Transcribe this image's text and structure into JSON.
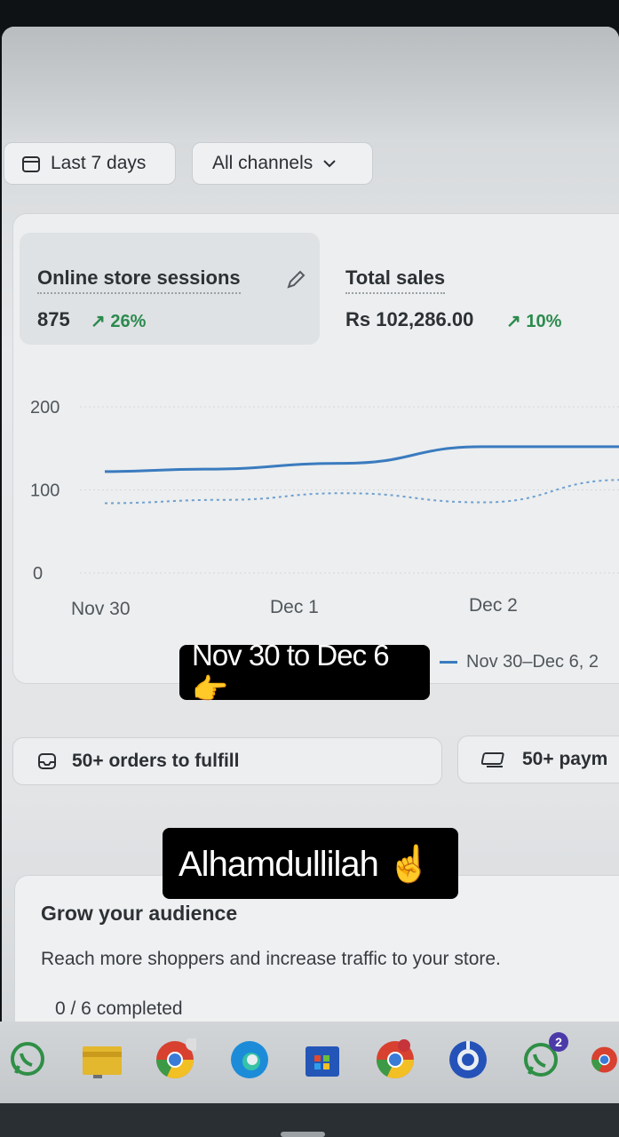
{
  "filters": {
    "date_range": "Last 7 days",
    "channels": "All channels"
  },
  "metrics": {
    "sessions": {
      "label": "Online store sessions",
      "value": "875",
      "delta": "26%"
    },
    "sales": {
      "label": "Total sales",
      "value": "Rs 102,286.00",
      "delta": "10%"
    }
  },
  "chart_data": {
    "type": "line",
    "x": [
      "Nov 30",
      "Dec 1",
      "Dec 2"
    ],
    "yticks": [
      "200",
      "100",
      "0"
    ],
    "ylim": [
      0,
      200
    ],
    "grid": true,
    "series": [
      {
        "name": "Nov 30–Dec 6, 2",
        "style": "solid",
        "color": "#3a7bbf",
        "points": [
          [
            0,
            122
          ],
          [
            0.5,
            125
          ],
          [
            1.2,
            132
          ],
          [
            1.9,
            152
          ],
          [
            2.6,
            152
          ]
        ]
      },
      {
        "style": "dotted",
        "color": "#6e9fcf",
        "points": [
          [
            0,
            84
          ],
          [
            0.6,
            88
          ],
          [
            1.2,
            96
          ],
          [
            1.9,
            85
          ],
          [
            2.6,
            112
          ]
        ]
      }
    ]
  },
  "legend": {
    "label": "Nov 30–Dec 6, 2"
  },
  "overlays": {
    "caption_1": "Nov 30 to Dec 6 👉",
    "caption_2": "Alhamdullilah ☝"
  },
  "tasks": {
    "orders": "50+ orders to fulfill",
    "payments": "50+ paym"
  },
  "grow": {
    "title": "Grow your audience",
    "description": "Reach more shoppers and increase traffic to your store.",
    "progress": "0 / 6 completed"
  },
  "taskbar": {
    "icons": [
      "whatsapp-icon",
      "file-explorer-icon",
      "chrome-icon",
      "edge-icon",
      "store-icon",
      "chrome-profile-icon",
      "chrome-alt-icon",
      "whatsapp-alt-icon",
      "chrome-edge-partial-icon"
    ],
    "whatsapp_badge": "2"
  }
}
